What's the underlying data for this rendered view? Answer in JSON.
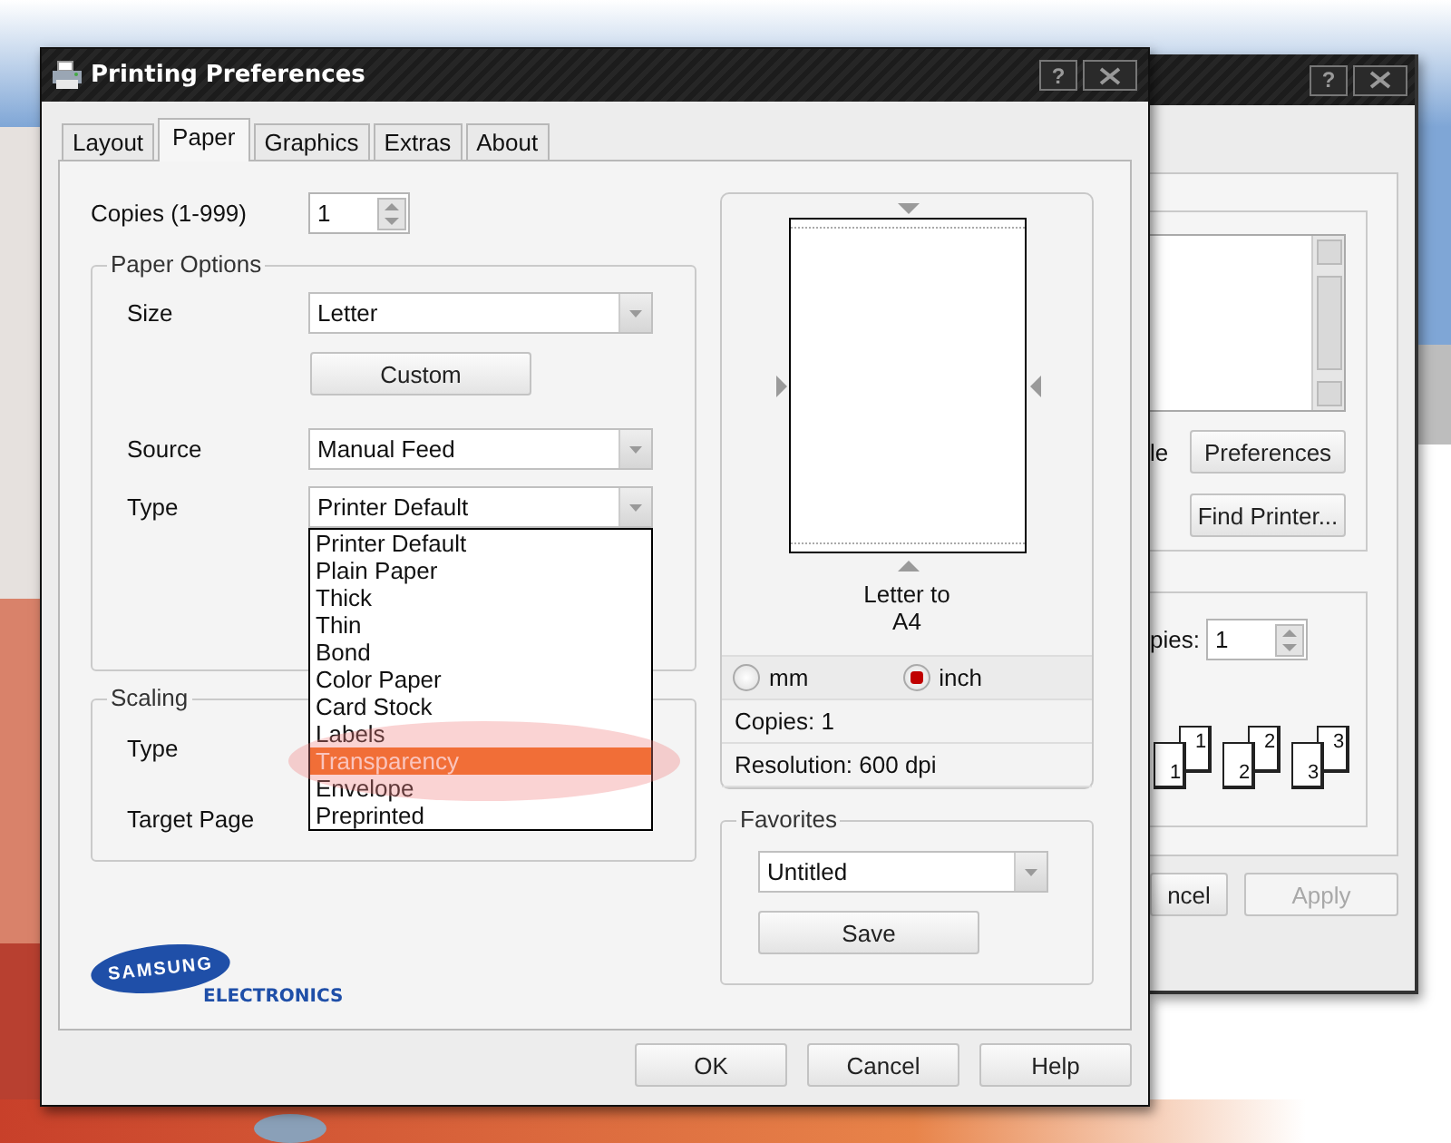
{
  "window": {
    "title": "Printing Preferences",
    "help_button": "?"
  },
  "tabs": [
    {
      "label": "Layout",
      "selected": false
    },
    {
      "label": "Paper",
      "selected": true
    },
    {
      "label": "Graphics",
      "selected": false
    },
    {
      "label": "Extras",
      "selected": false
    },
    {
      "label": "About",
      "selected": false
    }
  ],
  "copies": {
    "label": "Copies (1-999)",
    "value": "1"
  },
  "paper_options": {
    "title": "Paper Options",
    "size": {
      "label": "Size",
      "value": "Letter"
    },
    "custom_button": "Custom",
    "source": {
      "label": "Source",
      "value": "Manual Feed"
    },
    "type": {
      "label": "Type",
      "value": "Printer Default",
      "expanded": true,
      "options": [
        {
          "label": "Printer Default",
          "highlighted": false
        },
        {
          "label": "Plain Paper",
          "highlighted": false
        },
        {
          "label": "Thick",
          "highlighted": false
        },
        {
          "label": "Thin",
          "highlighted": false
        },
        {
          "label": "Bond",
          "highlighted": false
        },
        {
          "label": "Color Paper",
          "highlighted": false
        },
        {
          "label": "Card Stock",
          "highlighted": false
        },
        {
          "label": "Labels",
          "highlighted": false
        },
        {
          "label": "Transparency",
          "highlighted": true
        },
        {
          "label": "Envelope",
          "highlighted": false
        },
        {
          "label": "Preprinted",
          "highlighted": false
        }
      ]
    }
  },
  "scaling": {
    "title": "Scaling",
    "labels": [
      "Type",
      "Target Page"
    ]
  },
  "logo": {
    "name": "SAMSUNG",
    "subtitle": "ELECTRONICS"
  },
  "preview": {
    "caption": "Letter to A4",
    "units": [
      {
        "label": "mm",
        "selected": false
      },
      {
        "label": "inch",
        "selected": true
      }
    ],
    "info": [
      "Copies: 1",
      "Resolution: 600 dpi"
    ]
  },
  "favorites": {
    "title": "Favorites",
    "value": "Untitled",
    "save_button": "Save"
  },
  "buttons": [
    "OK",
    "Cancel",
    "Help"
  ],
  "back_window": {
    "help_button": "?",
    "label_fragment": "le",
    "buttons": [
      "Preferences",
      "Find Printer..."
    ],
    "copies_label": "pies:",
    "copies_value": "1",
    "collate_pairs": [
      [
        "1",
        "1"
      ],
      [
        "2",
        "2"
      ],
      [
        "3",
        "3"
      ]
    ],
    "footer_buttons": [
      {
        "label": "ncel",
        "disabled": false
      },
      {
        "label": "Apply",
        "disabled": true
      }
    ]
  }
}
